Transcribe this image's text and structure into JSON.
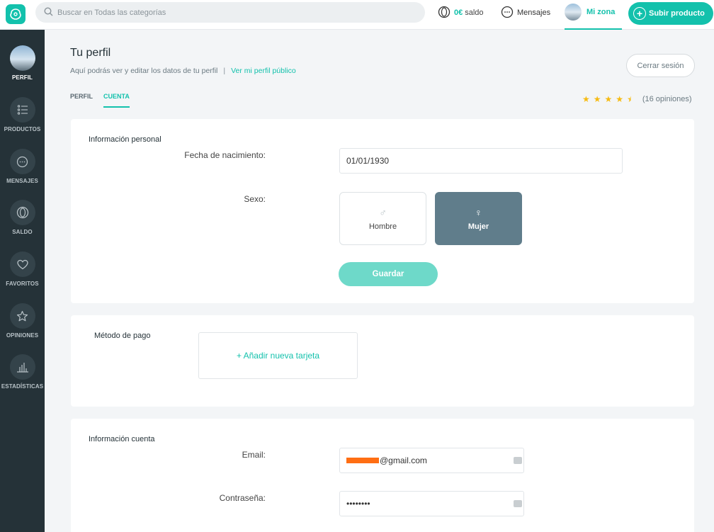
{
  "search": {
    "placeholder": "Buscar en Todas las categorías"
  },
  "nav": {
    "saldo_amount": "0€",
    "saldo_label": "saldo",
    "mensajes": "Mensajes",
    "mizona": "Mi zona",
    "subir": "Subir producto"
  },
  "sidebar": {
    "items": [
      {
        "label": "PERFIL"
      },
      {
        "label": "PRODUCTOS"
      },
      {
        "label": "MENSAJES"
      },
      {
        "label": "SALDO"
      },
      {
        "label": "FAVORITOS"
      },
      {
        "label": "OPINIONES"
      },
      {
        "label": "ESTADÍSTICAS"
      }
    ]
  },
  "header": {
    "title": "Tu perfil",
    "subtitle": "Aquí podrás ver y editar los datos de tu perfil",
    "separator": "|",
    "public_link": "Ver mi perfil público",
    "logout": "Cerrar sesión",
    "tabs": [
      "PERFIL",
      "CUENTA"
    ],
    "rating": {
      "stars": 4.5,
      "count_text": "(16 opiniones)"
    }
  },
  "personal": {
    "heading": "Información personal",
    "birth_label": "Fecha de nacimiento:",
    "birth_value": "01/01/1930",
    "sex_label": "Sexo:",
    "male": "Hombre",
    "female": "Mujer",
    "selected": "Mujer",
    "save": "Guardar"
  },
  "payment": {
    "heading": "Método de pago",
    "add_card": "+ Añadir nueva tarjeta"
  },
  "account": {
    "heading": "Información cuenta",
    "email_label": "Email:",
    "email_value": "@gmail.com",
    "password_label": "Contraseña:",
    "password_value": "••••••••"
  },
  "colors": {
    "accent": "#13c1ac",
    "sidebar_bg": "#253238",
    "selected_sex_bg": "#607d8b",
    "save_button": "#6ed9c9",
    "star": "#f6bb12"
  }
}
